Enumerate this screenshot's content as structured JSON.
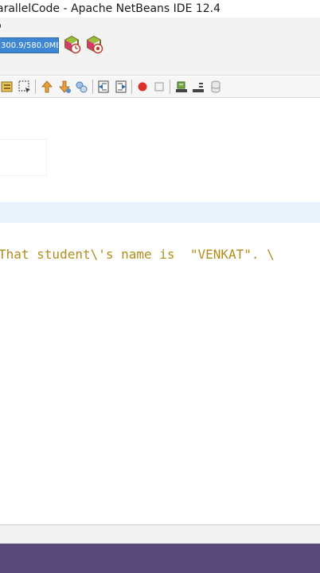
{
  "window": {
    "title": "arallelCode - Apache NetBeans IDE 12.4"
  },
  "menubar": {
    "visible_text": "p"
  },
  "memory": {
    "label": "300.9/580.0MB"
  },
  "toolbar": {
    "profile_icons": [
      "profile-snapshot-icon",
      "profile-heapdump-icon"
    ],
    "buttons": [
      "toggle-bookmark-icon",
      "select-rectangle-icon",
      "previous-bookmark-icon",
      "next-bookmark-icon",
      "toggle-highlight-icon",
      "shift-left-icon",
      "shift-right-icon",
      "start-macro-icon",
      "stop-macro-icon",
      "comment-icon",
      "uncomment-icon",
      "database-icon"
    ]
  },
  "editor": {
    "bracket_text": ")",
    "code_line": "That student\\'s name is  \"VENKAT\". \\"
  },
  "colors": {
    "string_literal": "#b08d1d",
    "memory_bar": "#3d87d4",
    "current_line": "#e9f1fa",
    "taskbar": "#574978"
  }
}
